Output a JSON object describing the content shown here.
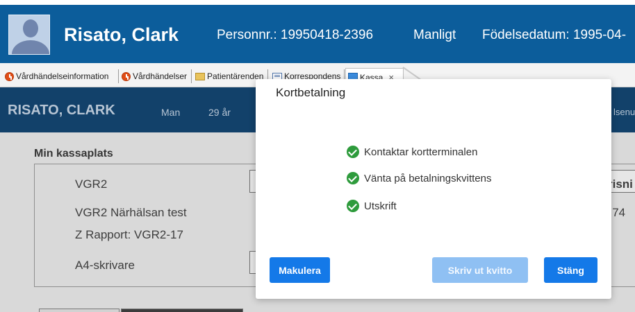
{
  "patient_header": {
    "name": "Risato, Clark",
    "personnr": "Personnr.: 19950418-2396",
    "gender": "Manligt",
    "dob": "Födelsedatum: 1995-04-"
  },
  "tabs": [
    {
      "label": "Vårdhändelseinformation",
      "icon": "clock-icon"
    },
    {
      "label": "Vårdhändelser",
      "icon": "clock-icon"
    },
    {
      "label": "Patientärenden",
      "icon": "folder-icon"
    },
    {
      "label": "Korrespondens",
      "icon": "mail-icon"
    },
    {
      "label": "Kassa",
      "icon": "register-icon",
      "active": true,
      "close": "×"
    }
  ],
  "app_bar": {
    "name": "RISATO, CLARK",
    "gender": "Man",
    "age": "29 år",
    "right_fragment": "lsenu"
  },
  "kassa": {
    "title": "Min kassaplats",
    "vgr2": "VGR2",
    "unit": "VGR2 Närhälsan test",
    "z_rapport": "Z Rapport: VGR2-17",
    "printer": "A4-skrivare",
    "right_button_fragment": "risni",
    "right_text_fragment": "v 74"
  },
  "modal": {
    "title": "Kortbetalning",
    "steps": [
      {
        "label": "Kontaktar kortterminalen",
        "status": "done"
      },
      {
        "label": "Vänta på betalningskvittens",
        "status": "done"
      },
      {
        "label": "Utskrift",
        "status": "done"
      }
    ],
    "buttons": {
      "cancel": "Makulera",
      "print_receipt": "Skriv ut kvitto",
      "close": "Stäng"
    }
  },
  "colors": {
    "header_blue": "#0c5d9b",
    "app_bar_dim": "#12416a",
    "primary_button": "#1479e8",
    "disabled_button": "#8fc0f3",
    "check_green": "#2e9b3c"
  }
}
